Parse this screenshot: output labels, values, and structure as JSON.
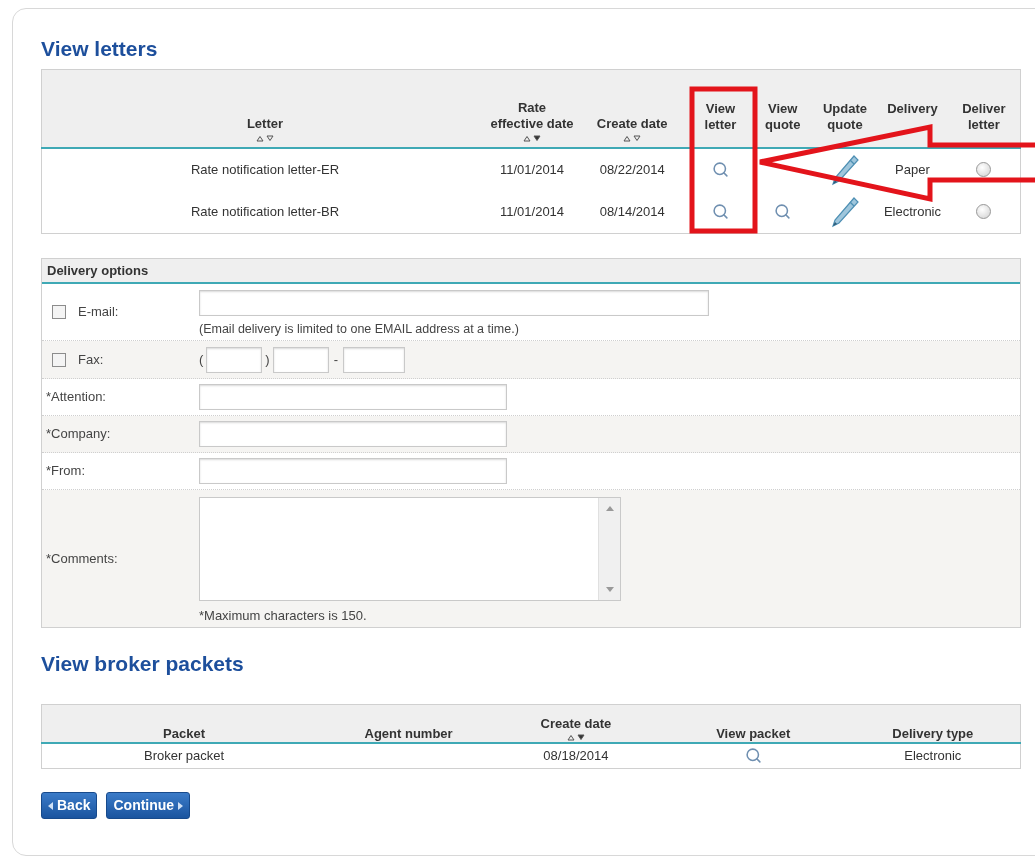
{
  "letters": {
    "title": "View letters",
    "columns": [
      {
        "label": "Letter",
        "sort_descending": false
      },
      {
        "label": "Rate effective date",
        "sort_descending": true
      },
      {
        "label": "Create date",
        "sort_descending": false
      },
      {
        "label": "View letter"
      },
      {
        "label": "View quote"
      },
      {
        "label": "Update quote"
      },
      {
        "label": "Delivery"
      },
      {
        "label": "Deliver letter"
      }
    ],
    "rows": [
      {
        "letter": "Rate notification letter-ER",
        "rate_effective_date": "11/01/2014",
        "create_date": "08/22/2014",
        "view_quote_visible": false,
        "delivery_type": "Paper",
        "selected": false
      },
      {
        "letter": "Rate notification letter-BR",
        "rate_effective_date": "11/01/2014",
        "create_date": "08/14/2014",
        "view_quote_visible": true,
        "delivery_type": "Electronic",
        "selected": false
      }
    ]
  },
  "delivery_options": {
    "title": "Delivery options",
    "email": {
      "label": "E-mail:",
      "checked": false,
      "note": "(Email delivery is limited to one EMAIL address at a time.)"
    },
    "fax": {
      "label": "Fax:",
      "checked": false,
      "open_paren": "(",
      "close_paren": ")",
      "dash": "-"
    },
    "fields": [
      {
        "label": "*Attention:"
      },
      {
        "label": "*Company:"
      },
      {
        "label": "*From:"
      }
    ],
    "comments": {
      "label": "*Comments:",
      "note": "*Maximum characters is 150."
    }
  },
  "broker_packets": {
    "title": "View broker packets",
    "columns": [
      {
        "label": "Packet"
      },
      {
        "label": "Agent number"
      },
      {
        "label": "Create date",
        "sort_descending": true
      },
      {
        "label": "View packet"
      },
      {
        "label": "Delivery type"
      }
    ],
    "rows": [
      {
        "packet": "Broker packet",
        "create_date": "08/18/2014",
        "delivery_type": "Electronic"
      }
    ]
  },
  "buttons": [
    {
      "label": "Back",
      "kind": "back"
    },
    {
      "label": "Continue",
      "kind": "continue"
    }
  ]
}
